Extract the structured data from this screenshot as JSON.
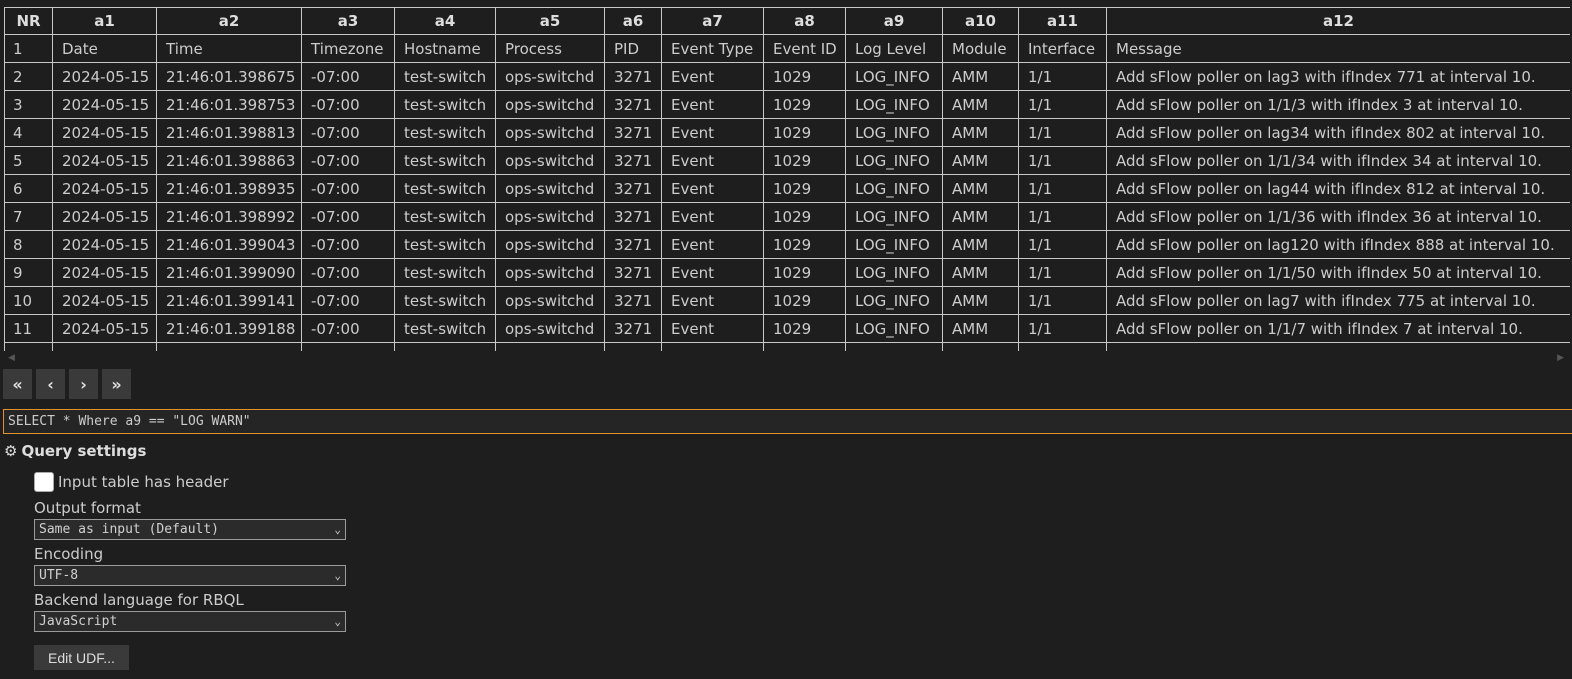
{
  "table": {
    "columns": [
      "NR",
      "a1",
      "a2",
      "a3",
      "a4",
      "a5",
      "a6",
      "a7",
      "a8",
      "a9",
      "a10",
      "a11",
      "a12"
    ],
    "rows": [
      [
        "1",
        "Date",
        "Time",
        "Timezone",
        "Hostname",
        "Process",
        "PID",
        "Event Type",
        "Event ID",
        "Log Level",
        "Module",
        "Interface",
        "Message"
      ],
      [
        "2",
        "2024-05-15",
        "21:46:01.398675",
        "-07:00",
        "test-switch",
        "ops-switchd",
        "3271",
        "Event",
        "1029",
        "LOG_INFO",
        "AMM",
        "1/1",
        "Add sFlow poller on lag3 with ifIndex 771 at interval 10."
      ],
      [
        "3",
        "2024-05-15",
        "21:46:01.398753",
        "-07:00",
        "test-switch",
        "ops-switchd",
        "3271",
        "Event",
        "1029",
        "LOG_INFO",
        "AMM",
        "1/1",
        "Add sFlow poller on 1/1/3 with ifIndex 3 at interval 10."
      ],
      [
        "4",
        "2024-05-15",
        "21:46:01.398813",
        "-07:00",
        "test-switch",
        "ops-switchd",
        "3271",
        "Event",
        "1029",
        "LOG_INFO",
        "AMM",
        "1/1",
        "Add sFlow poller on lag34 with ifIndex 802 at interval 10."
      ],
      [
        "5",
        "2024-05-15",
        "21:46:01.398863",
        "-07:00",
        "test-switch",
        "ops-switchd",
        "3271",
        "Event",
        "1029",
        "LOG_INFO",
        "AMM",
        "1/1",
        "Add sFlow poller on 1/1/34 with ifIndex 34 at interval 10."
      ],
      [
        "6",
        "2024-05-15",
        "21:46:01.398935",
        "-07:00",
        "test-switch",
        "ops-switchd",
        "3271",
        "Event",
        "1029",
        "LOG_INFO",
        "AMM",
        "1/1",
        "Add sFlow poller on lag44 with ifIndex 812 at interval 10."
      ],
      [
        "7",
        "2024-05-15",
        "21:46:01.398992",
        "-07:00",
        "test-switch",
        "ops-switchd",
        "3271",
        "Event",
        "1029",
        "LOG_INFO",
        "AMM",
        "1/1",
        "Add sFlow poller on 1/1/36 with ifIndex 36 at interval 10."
      ],
      [
        "8",
        "2024-05-15",
        "21:46:01.399043",
        "-07:00",
        "test-switch",
        "ops-switchd",
        "3271",
        "Event",
        "1029",
        "LOG_INFO",
        "AMM",
        "1/1",
        "Add sFlow poller on lag120 with ifIndex 888 at interval 10."
      ],
      [
        "9",
        "2024-05-15",
        "21:46:01.399090",
        "-07:00",
        "test-switch",
        "ops-switchd",
        "3271",
        "Event",
        "1029",
        "LOG_INFO",
        "AMM",
        "1/1",
        "Add sFlow poller on 1/1/50 with ifIndex 50 at interval 10."
      ],
      [
        "10",
        "2024-05-15",
        "21:46:01.399141",
        "-07:00",
        "test-switch",
        "ops-switchd",
        "3271",
        "Event",
        "1029",
        "LOG_INFO",
        "AMM",
        "1/1",
        "Add sFlow poller on lag7 with ifIndex 775 at interval 10."
      ],
      [
        "11",
        "2024-05-15",
        "21:46:01.399188",
        "-07:00",
        "test-switch",
        "ops-switchd",
        "3271",
        "Event",
        "1029",
        "LOG_INFO",
        "AMM",
        "1/1",
        "Add sFlow poller on 1/1/7 with ifIndex 7 at interval 10."
      ],
      [
        "",
        "",
        "",
        "",
        "",
        "",
        "",
        "",
        "",
        "",
        "",
        "",
        ""
      ]
    ]
  },
  "pager": {
    "first": "«",
    "prev": "‹",
    "next": "›",
    "last": "»"
  },
  "query": {
    "value": "SELECT * Where a9 == \"LOG WARN\""
  },
  "settings": {
    "gear_icon": "⚙",
    "title": "Query settings",
    "header_checkbox_label": "Input table has header",
    "header_checkbox_checked": false,
    "output_format_label": "Output format",
    "output_format_value": "Same as input (Default)",
    "encoding_label": "Encoding",
    "encoding_value": "UTF-8",
    "backend_label": "Backend language for RBQL",
    "backend_value": "JavaScript",
    "udf_button": "Edit UDF..."
  },
  "colors": {
    "background": "#1e1e1e",
    "query_border": "#e2912f"
  }
}
